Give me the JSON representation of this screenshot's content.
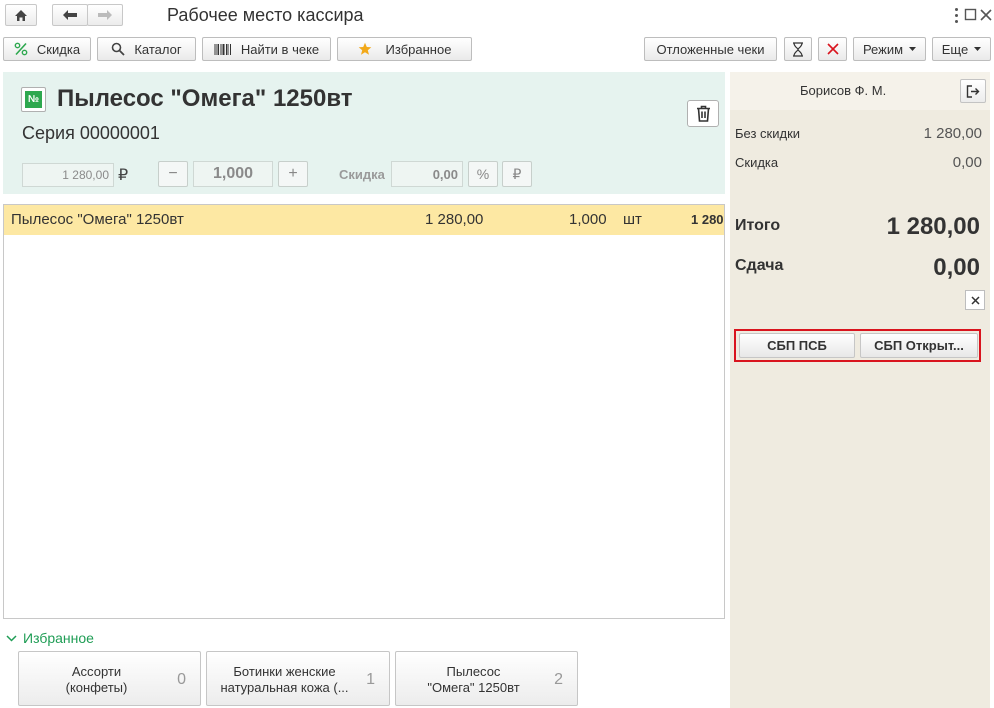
{
  "window": {
    "title": "Рабочее место кассира"
  },
  "toolbar": {
    "discount": "Скидка",
    "catalog": "Каталог",
    "find_in_receipt": "Найти в чеке",
    "favorites": "Избранное",
    "deferred": "Отложенные чеки",
    "mode": "Режим",
    "more": "Еще"
  },
  "item": {
    "badge": "№",
    "name": "Пылесос \"Омега\" 1250вт",
    "series": "Серия 00000001",
    "price": "1 280,00",
    "currency": "₽",
    "quantity": "1,000",
    "discount_label": "Скидка",
    "discount_value": "0,00",
    "percent_symbol": "%",
    "ruble_symbol": "₽"
  },
  "receipt_rows": [
    {
      "name": "Пылесос \"Омега\" 1250вт",
      "price": "1 280,00",
      "qty": "1,000",
      "unit": "шт",
      "sum": "1 280"
    }
  ],
  "favorites": {
    "header": "Избранное",
    "tiles": [
      {
        "line1": "Ассорти",
        "line2": "(конфеты)",
        "count": "0"
      },
      {
        "line1": "Ботинки женские",
        "line2": "натуральная кожа (...",
        "count": "1"
      },
      {
        "line1": "Пылесос",
        "line2": "\"Омега\" 1250вт",
        "count": "2"
      }
    ]
  },
  "panel": {
    "cashier": "Борисов Ф. М.",
    "without_discount_label": "Без скидки",
    "without_discount_value": "1 280,00",
    "discount_label": "Скидка",
    "discount_value": "0,00",
    "total_label": "Итого",
    "total_value": "1 280,00",
    "change_label": "Сдача",
    "change_value": "0,00",
    "sbp_psb": "СБП ПСБ",
    "sbp_open": "СБП Открыт..."
  },
  "colors": {
    "card_bg": "#e6f3ef",
    "row_highlight": "#fde8a3",
    "panel_bg": "#efebe0",
    "accent_green": "#1f9d55",
    "highlight_red": "#d9141e"
  }
}
